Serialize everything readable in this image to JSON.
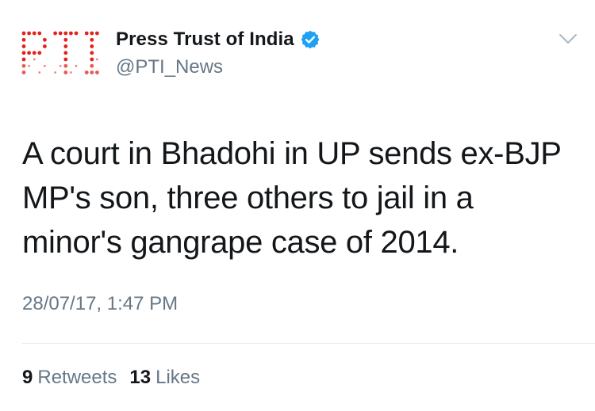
{
  "tweet": {
    "author": {
      "display_name": "Press Trust of India",
      "handle": "@PTI_News",
      "verified": true,
      "avatar_logo_text": "PTI",
      "avatar_color": "#e2231a"
    },
    "text": "A court in Bhadohi in UP sends ex-BJP MP's son, three others to jail in a minor's gangrape case of 2014.",
    "timestamp": "28/07/17, 1:47 PM",
    "stats": {
      "retweets_count": "9",
      "retweets_label": "Retweets",
      "likes_count": "13",
      "likes_label": "Likes"
    },
    "icons": {
      "verified": "verified-badge-icon",
      "menu": "chevron-down-icon"
    }
  },
  "colors": {
    "verified_blue": "#1da1f2",
    "secondary_text": "#657786",
    "primary_text": "#14171a"
  }
}
